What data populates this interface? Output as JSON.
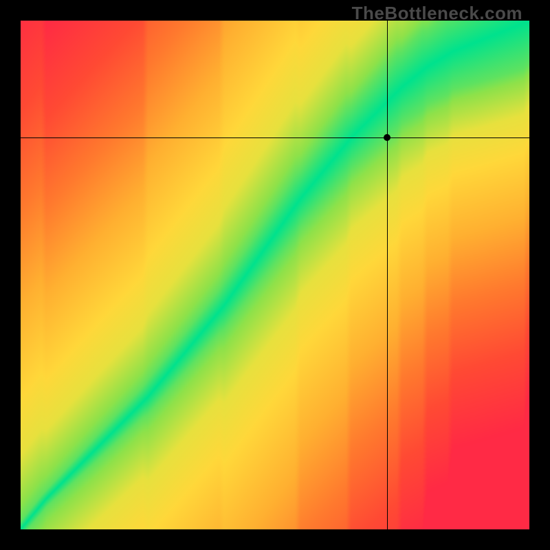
{
  "watermark": "TheBottleneck.com",
  "chart_data": {
    "type": "heatmap",
    "title": "",
    "xlabel": "",
    "ylabel": "",
    "xlim": [
      0,
      100
    ],
    "ylim": [
      0,
      100
    ],
    "crosshair": {
      "x": 72,
      "y": 77
    },
    "optimal_curve": {
      "description": "Ideal-pair ridge (green band center) as y(x) across the plot, 0–100 scale",
      "x": [
        0,
        5,
        10,
        15,
        20,
        25,
        30,
        35,
        40,
        45,
        50,
        55,
        60,
        65,
        70,
        75,
        80,
        85,
        90,
        95,
        100
      ],
      "y": [
        0,
        6,
        11,
        16,
        21,
        26,
        32,
        38,
        44,
        51,
        58,
        65,
        71,
        77,
        82,
        87,
        91,
        94,
        96,
        98,
        100
      ]
    },
    "band_halfwidth": {
      "description": "Approx half-width of green band along x, per sampled x",
      "x": [
        0,
        5,
        10,
        15,
        20,
        25,
        30,
        35,
        40,
        45,
        50,
        55,
        60,
        65,
        70,
        75,
        80,
        85,
        90,
        95,
        100
      ],
      "hw": [
        1,
        1.2,
        1.5,
        1.8,
        2.0,
        2.2,
        2.4,
        2.6,
        2.8,
        3.0,
        3.3,
        3.6,
        4.0,
        4.4,
        4.9,
        5.5,
        6.2,
        6.9,
        7.5,
        8.0,
        8.5
      ]
    },
    "color_scale": {
      "description": "distance-from-ridge → color, normalized distance 0..1",
      "stops": [
        {
          "d": 0.0,
          "color": "#00e38e"
        },
        {
          "d": 0.09,
          "color": "#8fe24a"
        },
        {
          "d": 0.18,
          "color": "#e8e13e"
        },
        {
          "d": 0.28,
          "color": "#ffd83a"
        },
        {
          "d": 0.45,
          "color": "#ffb031"
        },
        {
          "d": 0.62,
          "color": "#ff7a2e"
        },
        {
          "d": 0.8,
          "color": "#ff4a34"
        },
        {
          "d": 1.0,
          "color": "#ff2a45"
        }
      ]
    },
    "corners": {
      "top_left": "red",
      "top_right": "yellow",
      "bottom_left": "green-origin",
      "bottom_right": "red"
    }
  }
}
